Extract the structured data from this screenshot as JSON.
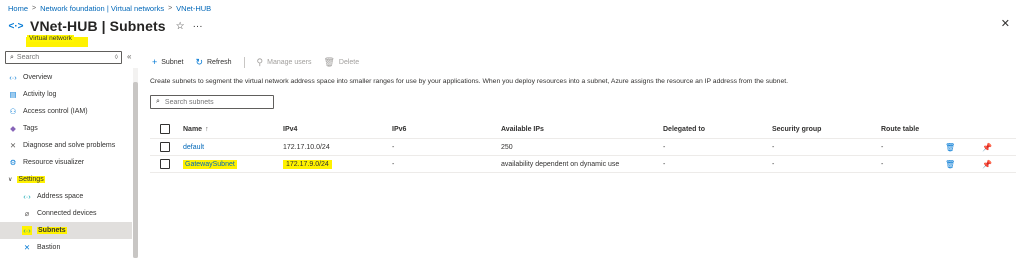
{
  "breadcrumb": [
    "Home",
    "Network foundation | Virtual networks",
    "VNet-HUB"
  ],
  "header": {
    "title": "VNet-HUB | Subnets",
    "resource_type": "Virtual network",
    "pin_glyph": "☆",
    "more_glyph": "···",
    "close_glyph": "✕"
  },
  "sidebar": {
    "search_placeholder": "Search",
    "items": [
      {
        "label": "Overview",
        "icon": "vnet-icon"
      },
      {
        "label": "Activity log",
        "icon": "log-icon"
      },
      {
        "label": "Access control (IAM)",
        "icon": "people-icon"
      },
      {
        "label": "Tags",
        "icon": "tag-icon"
      },
      {
        "label": "Diagnose and solve problems",
        "icon": "wrench-icon"
      },
      {
        "label": "Resource visualizer",
        "icon": "visualizer-icon"
      },
      {
        "label": "Settings",
        "icon": "chevron-down-icon"
      },
      {
        "label": "Address space",
        "icon": "address-icon"
      },
      {
        "label": "Connected devices",
        "icon": "plug-icon"
      },
      {
        "label": "Subnets",
        "icon": "subnet-icon"
      },
      {
        "label": "Bastion",
        "icon": "bastion-icon"
      }
    ]
  },
  "toolbar": {
    "add_subnet": "Subnet",
    "refresh": "Refresh",
    "manage_users": "Manage users",
    "delete": "Delete"
  },
  "description": "Create subnets to segment the virtual network address space into smaller ranges for use by your applications. When you deploy resources into a subnet, Azure assigns the resource an IP address from the subnet.",
  "subnet_search_placeholder": "Search subnets",
  "table": {
    "columns": [
      "Name",
      "IPv4",
      "IPv6",
      "Available IPs",
      "Delegated to",
      "Security group",
      "Route table"
    ],
    "sort_glyph": "↑",
    "rows": [
      {
        "name": "default",
        "ipv4": "172.17.10.0/24",
        "ipv6": "-",
        "available": "250",
        "delegated": "-",
        "security": "-",
        "route": "-"
      },
      {
        "name": "GatewaySubnet",
        "ipv4": "172.17.9.0/24",
        "ipv6": "-",
        "available": "availability dependent on dynamic use",
        "delegated": "-",
        "security": "-",
        "route": "-"
      }
    ]
  },
  "colors": {
    "accent": "#0078d4",
    "link": "#0067b8",
    "highlight": "#fff200"
  }
}
